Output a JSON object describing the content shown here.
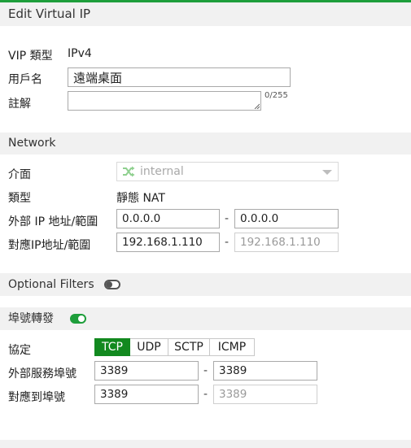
{
  "header": {
    "title": "Edit Virtual IP"
  },
  "basic": {
    "vip_type_label": "VIP 類型",
    "vip_type_value": "IPv4",
    "name_label": "用戶名",
    "name_value": "遠端桌面",
    "comment_label": "註解",
    "comment_value": "",
    "comment_counter": "0/255"
  },
  "network": {
    "title": "Network",
    "interface_label": "介面",
    "interface_value": "internal",
    "type_label": "類型",
    "type_value": "靜態 NAT",
    "ext_ip_label": "外部 IP 地址/範圍",
    "ext_ip_start": "0.0.0.0",
    "ext_ip_end": "0.0.0.0",
    "mapped_ip_label": "對應IP地址/範圍",
    "mapped_ip_start": "192.168.1.110",
    "mapped_ip_end": "192.168.1.110",
    "dash": "-"
  },
  "optional_filters": {
    "title": "Optional Filters",
    "enabled": false
  },
  "port_forwarding": {
    "title": "埠號轉發",
    "enabled": true,
    "protocol_label": "協定",
    "protocols": [
      "TCP",
      "UDP",
      "SCTP",
      "ICMP"
    ],
    "selected_protocol": "TCP",
    "ext_port_label": "外部服務埠號",
    "ext_port_start": "3389",
    "ext_port_end": "3389",
    "mapped_port_label": "對應到埠號",
    "mapped_port_start": "3389",
    "mapped_port_end": "3389",
    "dash": "-"
  },
  "colors": {
    "accent": "#1e9e3b",
    "active_button": "#12891f",
    "section_bg": "#f1f1f1"
  }
}
